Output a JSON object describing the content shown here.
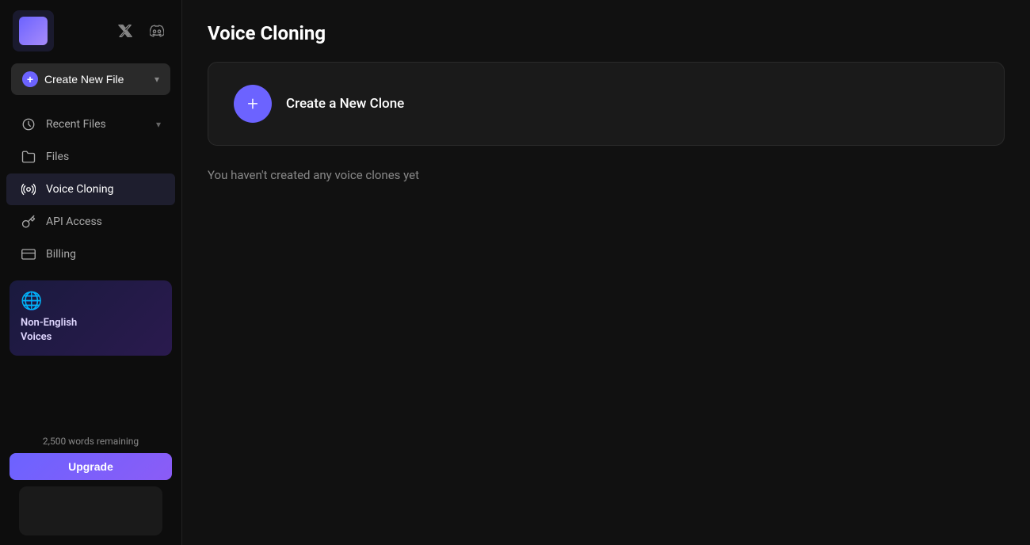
{
  "sidebar": {
    "logo_alt": "App Logo",
    "social_links": [
      {
        "name": "twitter",
        "label": "𝕏"
      },
      {
        "name": "discord",
        "label": "⊕"
      }
    ],
    "create_button": {
      "label": "Create New File",
      "icon": "+"
    },
    "nav_items": [
      {
        "id": "recent-files",
        "label": "Recent Files",
        "icon": "clock",
        "has_chevron": true
      },
      {
        "id": "files",
        "label": "Files",
        "icon": "folder"
      },
      {
        "id": "voice-cloning",
        "label": "Voice Cloning",
        "icon": "waveform",
        "active": true
      },
      {
        "id": "api-access",
        "label": "API Access",
        "icon": "key"
      },
      {
        "id": "billing",
        "label": "Billing",
        "icon": "credit-card"
      }
    ],
    "promo": {
      "icon": "🌐",
      "title": "Non-English\nVoices"
    },
    "words_remaining": "2,500 words remaining",
    "upgrade_label": "Upgrade"
  },
  "main": {
    "page_title": "Voice Cloning",
    "create_clone_label": "Create a New Clone",
    "empty_state_text": "You haven't created any voice clones yet"
  }
}
